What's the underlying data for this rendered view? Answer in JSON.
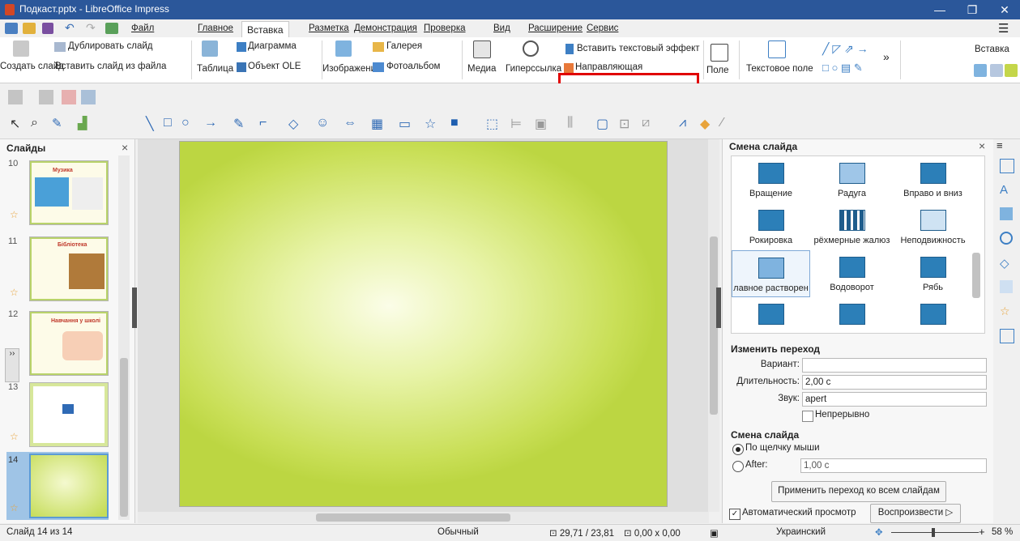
{
  "window": {
    "title": "Подкаст.pptx - LibreOffice Impress",
    "min": "—",
    "restore": "❐",
    "close": "✕"
  },
  "menu": {
    "file": "Файл",
    "home": "Главное",
    "insert": "Вставка",
    "layout": "Разметка",
    "show": "Демонстрация",
    "review": "Проверка",
    "view": "Вид",
    "ext": "Расширение",
    "tools": "Сервис"
  },
  "ribbon": {
    "dup_slide": "Дублировать слайд",
    "new_slide": "Создать слайд",
    "insert_from_file": "Вставить слайд из файла",
    "table": "Таблица",
    "chart": "Диаграмма",
    "ole": "Объект OLE",
    "image": "Изображение",
    "gallery": "Галерея",
    "photoalbum": "Фотоальбом",
    "media": "Медиа",
    "hyperlink": "Гиперссылка",
    "text_effect": "Вставить текстовый эффект",
    "guide": "Направляющая",
    "field": "Поле",
    "textbox": "Текстовое поле",
    "insert_menu": "Вставка",
    "more": "»"
  },
  "slides_panel": {
    "title": "Слайды",
    "close": "×",
    "thumbs": [
      {
        "num": "10",
        "caption": "Музика"
      },
      {
        "num": "11",
        "caption": "Бібліотека"
      },
      {
        "num": "12",
        "caption": "Навчання у школі"
      },
      {
        "num": "13",
        "caption": ""
      },
      {
        "num": "14",
        "caption": ""
      }
    ]
  },
  "transition_panel": {
    "title": "Смена слайда",
    "effects": [
      "Вращение",
      "Радуга",
      "Вправо и вниз",
      "Рокировка",
      "рёхмерные жалюз",
      "Неподвижность",
      "лавное растворен",
      "Водоворот",
      "Рябь",
      "",
      "",
      ""
    ],
    "modify_title": "Изменить переход",
    "variant_label": "Вариант:",
    "variant_value": "",
    "duration_label": "Длительность:",
    "duration_value": "2,00 с",
    "sound_label": "Звук:",
    "sound_value": "apert",
    "loop_label": "Непрерывно",
    "advance_title": "Смена слайда",
    "on_click": "По щелчку мыши",
    "after": "After:",
    "after_value": "1,00 с",
    "apply_all": "Применить переход ко всем слайдам",
    "autopreview": "Автоматический просмотр",
    "play": "Воспроизвести"
  },
  "status": {
    "slide_info": "Слайд 14 из 14",
    "view_mode": "Обычный",
    "position": "29,71 / 23,81",
    "size": "0,00 x 0,00",
    "language": "Украинский",
    "zoom": "58 %"
  },
  "colors": {
    "titlebar": "#2b579a",
    "highlight": "#e00000",
    "slide_edge": "#bcd642",
    "slide_center": "#fbfde8",
    "accent": "#2c7fb8"
  }
}
